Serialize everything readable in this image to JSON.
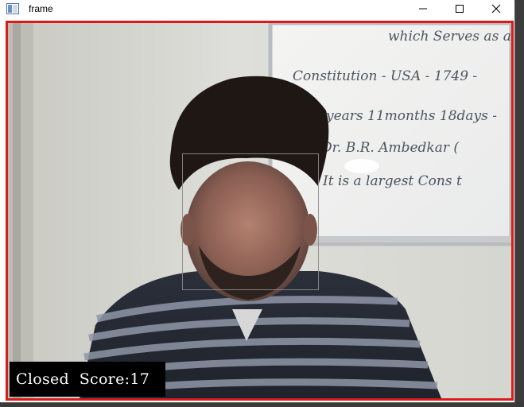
{
  "window": {
    "title": "frame",
    "icon": "opencv-window-icon",
    "buttons": [
      "minimize-icon",
      "maximize-icon",
      "close-icon"
    ]
  },
  "feed": {
    "status_text": "Closed  Score:17",
    "status_label": "Closed",
    "score": 17,
    "border_color": "#d81c1c"
  },
  "whiteboard": {
    "lines": [
      "which Serves as a",
      "Constitution - USA - 1749 -",
      "years 11months 18days -",
      "Dr. B.R. Ambedkar (",
      "It is a largest Cons t"
    ]
  }
}
